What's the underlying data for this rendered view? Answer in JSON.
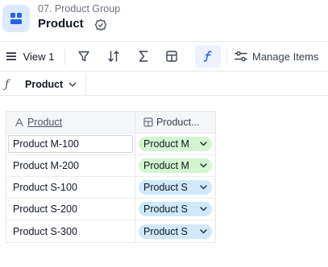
{
  "header": {
    "breadcrumb": "07. Product Group",
    "title": "Product"
  },
  "toolbar": {
    "view_label": "View 1",
    "manage_items_label": "Manage Items"
  },
  "formula_bar": {
    "fx_symbol": "ƒ",
    "field_label": "Product"
  },
  "grid": {
    "columns": [
      "Product",
      "Product..."
    ],
    "rows": [
      {
        "product": "Product M-100",
        "group": "Product M"
      },
      {
        "product": "Product M-200",
        "group": "Product M"
      },
      {
        "product": "Product S-100",
        "group": "Product S"
      },
      {
        "product": "Product S-200",
        "group": "Product S"
      },
      {
        "product": "Product S-300",
        "group": "Product S"
      }
    ]
  },
  "colors": {
    "tag_product_m": "#d3f5cf",
    "tag_product_s": "#cfe8fb",
    "accent": "#2563eb"
  }
}
